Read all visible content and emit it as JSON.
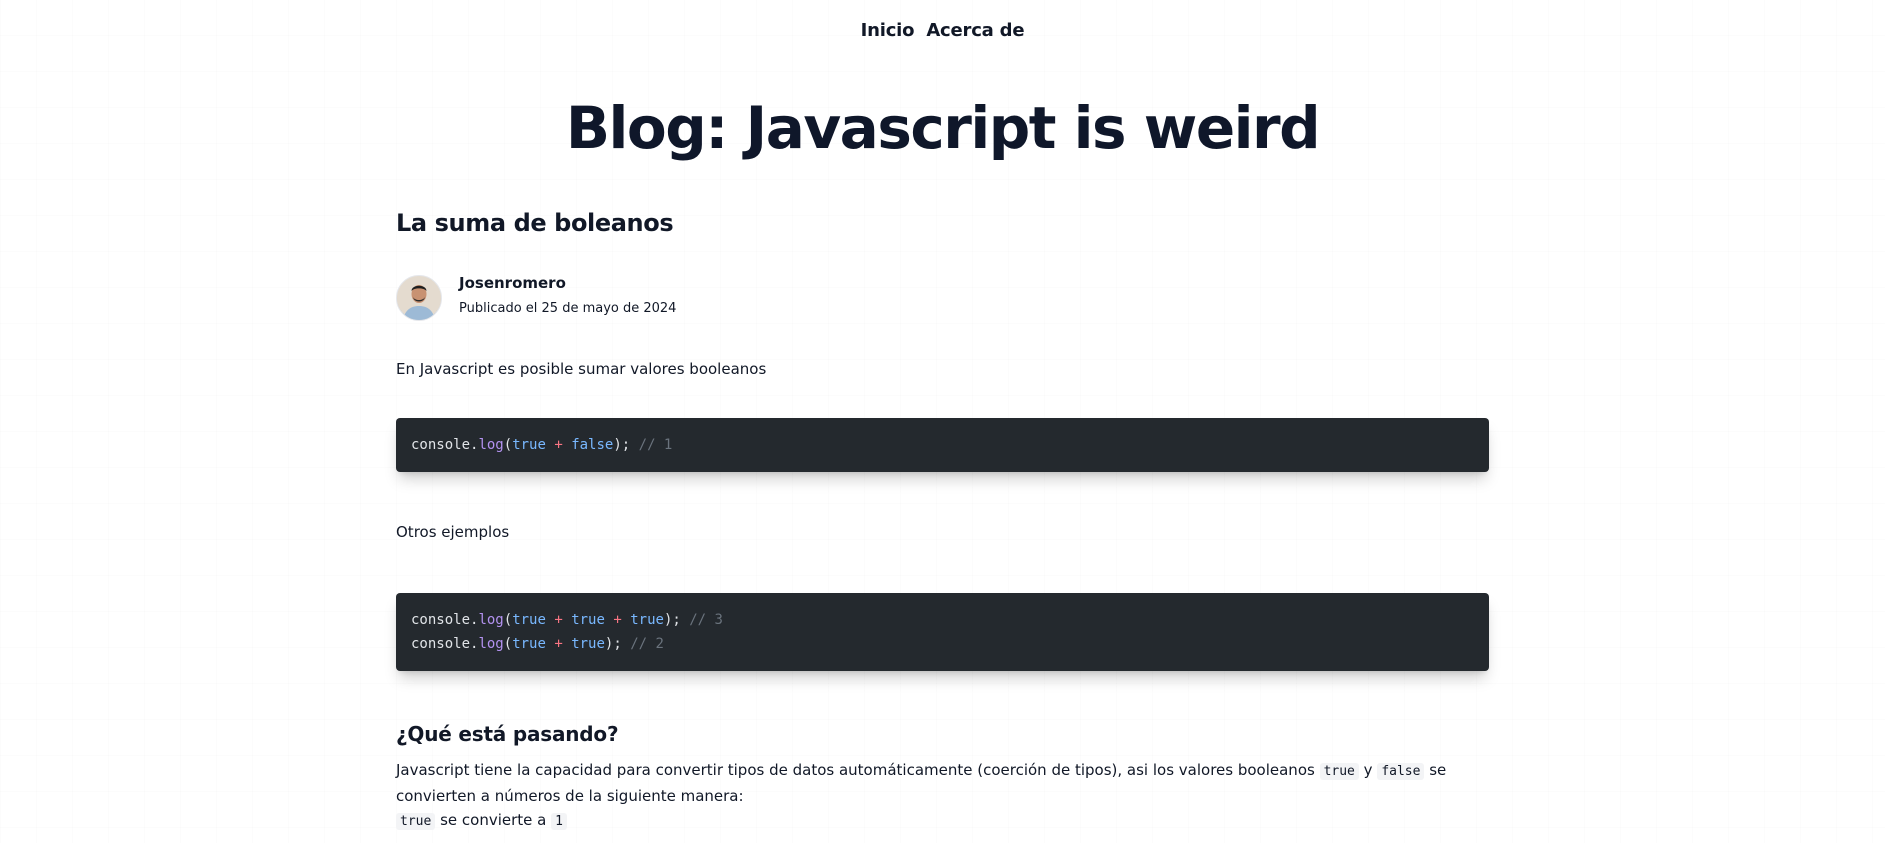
{
  "nav": {
    "items": [
      {
        "label": "Inicio"
      },
      {
        "label": "Acerca de"
      }
    ]
  },
  "site_title": "Blog: Javascript is weird",
  "post": {
    "title": "La suma de boleanos",
    "author": {
      "name": "Josenromero",
      "published": "Publicado el 25 de mayo de 2024"
    },
    "intro": "En Javascript es posible sumar valores booleanos",
    "code1": {
      "obj": "console",
      "dot": ".",
      "fn": "log",
      "lp": "(",
      "a": "true",
      "op": " + ",
      "b": "false",
      "rp": ");",
      "comment": " // 1"
    },
    "other_examples": "Otros ejemplos",
    "code2": {
      "line1": {
        "obj": "console",
        "dot": ".",
        "fn": "log",
        "lp": "(",
        "a": "true",
        "op1": " + ",
        "b": "true",
        "op2": " + ",
        "c": "true",
        "rp": ");",
        "comment": " // 3"
      },
      "line2": {
        "obj": "console",
        "dot": ".",
        "fn": "log",
        "lp": "(",
        "a": "true",
        "op": " + ",
        "b": "true",
        "rp": ");",
        "comment": " // 2"
      }
    },
    "section_title": "¿Qué está pasando?",
    "explanation": {
      "before": "Javascript tiene la capacidad para convertir tipos de datos automáticamente (coerción de tipos), asi los valores booleanos ",
      "code_true": "true",
      "middle": " y ",
      "code_false": "false",
      "after": " se convierten a números de la siguiente manera:"
    },
    "rule": {
      "code_true": "true",
      "text": " se convierte a ",
      "code_one": "1"
    }
  },
  "colors": {
    "code_bg": "#24292e",
    "code_fn": "#b392f0",
    "code_kw": "#79b8ff",
    "code_op": "#f97583",
    "code_comment": "#6a737d"
  }
}
